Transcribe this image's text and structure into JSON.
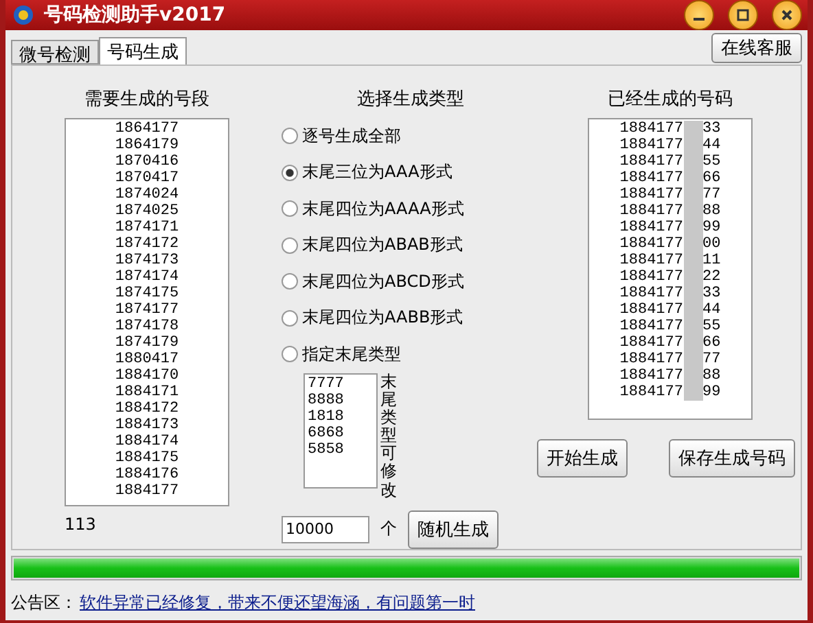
{
  "window": {
    "title": "号码检测助手v2017"
  },
  "tabs": [
    {
      "label": "微号检测",
      "selected": false
    },
    {
      "label": "号码生成",
      "selected": true
    }
  ],
  "service_button": "在线客服",
  "segments": {
    "title": "需要生成的号段",
    "items": [
      "1864177",
      "1864179",
      "1870416",
      "1870417",
      "1874024",
      "1874025",
      "1874171",
      "1874172",
      "1874173",
      "1874174",
      "1874175",
      "1874177",
      "1874178",
      "1874179",
      "1880417",
      "1884170",
      "1884171",
      "1884172",
      "1884173",
      "1884174",
      "1884175",
      "1884176",
      "1884177"
    ],
    "count": "113"
  },
  "types": {
    "title": "选择生成类型",
    "options": [
      {
        "label": "逐号生成全部",
        "selected": false
      },
      {
        "label": "末尾三位为AAA形式",
        "selected": true
      },
      {
        "label": "末尾四位为AAAA形式",
        "selected": false
      },
      {
        "label": "末尾四位为ABAB形式",
        "selected": false
      },
      {
        "label": "末尾四位为ABCD形式",
        "selected": false
      },
      {
        "label": "末尾四位为AABB形式",
        "selected": false
      },
      {
        "label": "指定末尾类型",
        "selected": false
      }
    ],
    "custom_tails": [
      "7777",
      "8888",
      "1818",
      "6868",
      "5858"
    ],
    "custom_note": "末尾类型可修改",
    "quantity": "10000",
    "unit": "个",
    "random_button": "随机生成"
  },
  "generated": {
    "title": "已经生成的号码",
    "items": [
      {
        "prefix": "1884177",
        "suffix": "33"
      },
      {
        "prefix": "1884177",
        "suffix": "44"
      },
      {
        "prefix": "1884177",
        "suffix": "55"
      },
      {
        "prefix": "1884177",
        "suffix": "66"
      },
      {
        "prefix": "1884177",
        "suffix": "77"
      },
      {
        "prefix": "1884177",
        "suffix": "88"
      },
      {
        "prefix": "1884177",
        "suffix": "99"
      },
      {
        "prefix": "1884177",
        "suffix": "00"
      },
      {
        "prefix": "1884177",
        "suffix": "11"
      },
      {
        "prefix": "1884177",
        "suffix": "22"
      },
      {
        "prefix": "1884177",
        "suffix": "33"
      },
      {
        "prefix": "1884177",
        "suffix": "44"
      },
      {
        "prefix": "1884177",
        "suffix": "55"
      },
      {
        "prefix": "1884177",
        "suffix": "66"
      },
      {
        "prefix": "1884177",
        "suffix": "77"
      },
      {
        "prefix": "1884177",
        "suffix": "88"
      },
      {
        "prefix": "1884177",
        "suffix": "99"
      }
    ],
    "start_button": "开始生成",
    "save_button": "保存生成号码"
  },
  "progress": {
    "level": 1
  },
  "notice": {
    "label": "公告区：",
    "text": "软件异常已经修复，带来不便还望海涵，有问题第一时"
  }
}
